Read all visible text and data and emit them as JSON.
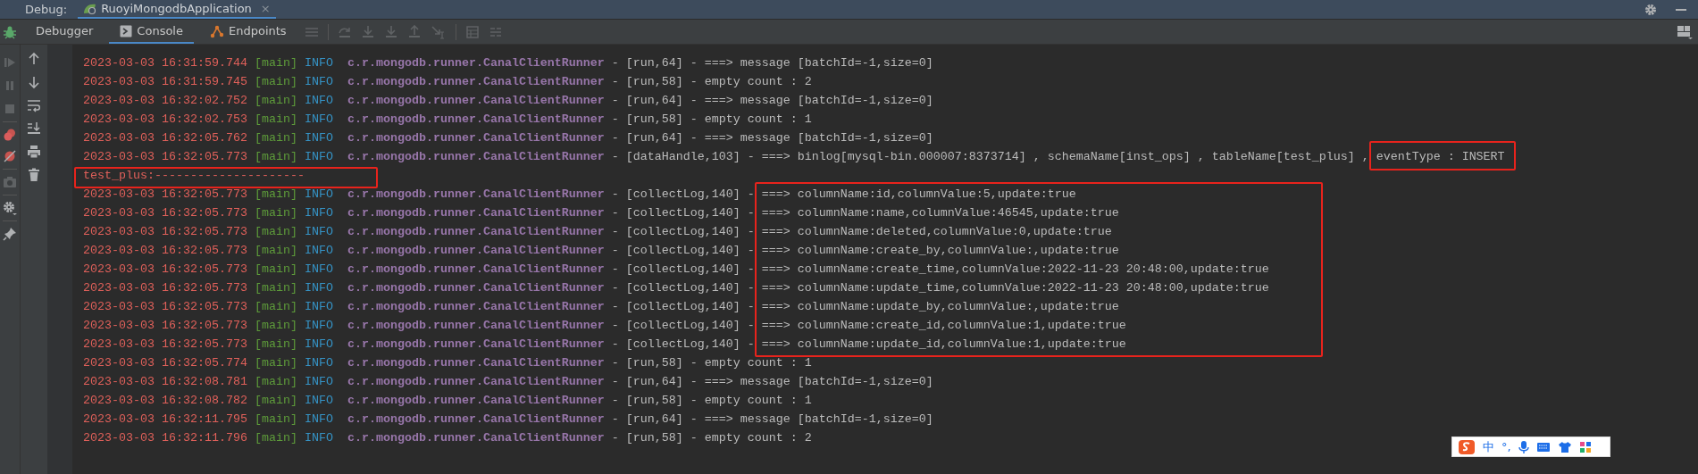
{
  "debug_bar": {
    "label": "Debug:",
    "tab": {
      "title": "RuoyiMongodbApplication",
      "selected": true,
      "close": "×"
    }
  },
  "toolbar": {
    "tabs": [
      {
        "label": "Debugger",
        "selected": false,
        "kind": "text"
      },
      {
        "label": "Console",
        "selected": true,
        "kind": "console"
      },
      {
        "label": "Endpoints",
        "selected": false,
        "kind": "endpoints"
      }
    ]
  },
  "console_lines": [
    {
      "kind": "log",
      "timestamp": "2023-03-03 16:31:59.744",
      "thread": "[main]",
      "level": "INFO",
      "logger": "c.r.mongodb.runner.CanalClientRunner",
      "message": "- [run,64] - ===> message [batchId=-1,size=0]"
    },
    {
      "kind": "log",
      "timestamp": "2023-03-03 16:31:59.745",
      "thread": "[main]",
      "level": "INFO",
      "logger": "c.r.mongodb.runner.CanalClientRunner",
      "message": "- [run,58] - empty count : 2"
    },
    {
      "kind": "log",
      "timestamp": "2023-03-03 16:32:02.752",
      "thread": "[main]",
      "level": "INFO",
      "logger": "c.r.mongodb.runner.CanalClientRunner",
      "message": "- [run,64] - ===> message [batchId=-1,size=0]"
    },
    {
      "kind": "log",
      "timestamp": "2023-03-03 16:32:02.753",
      "thread": "[main]",
      "level": "INFO",
      "logger": "c.r.mongodb.runner.CanalClientRunner",
      "message": "- [run,58] - empty count : 1"
    },
    {
      "kind": "log",
      "timestamp": "2023-03-03 16:32:05.762",
      "thread": "[main]",
      "level": "INFO",
      "logger": "c.r.mongodb.runner.CanalClientRunner",
      "message": "- [run,64] - ===> message [batchId=-1,size=0]"
    },
    {
      "kind": "log",
      "timestamp": "2023-03-03 16:32:05.773",
      "thread": "[main]",
      "level": "INFO",
      "logger": "c.r.mongodb.runner.CanalClientRunner",
      "message": "- [dataHandle,103] - ===> binlog[mysql-bin.000007:8373714] , schemaName[inst_ops] , tableName[test_plus] , eventType : INSERT"
    },
    {
      "kind": "plain",
      "text": "test_plus:---------------------"
    },
    {
      "kind": "log",
      "timestamp": "2023-03-03 16:32:05.773",
      "thread": "[main]",
      "level": "INFO",
      "logger": "c.r.mongodb.runner.CanalClientRunner",
      "message": "- [collectLog,140] - ===> columnName:id,columnValue:5,update:true"
    },
    {
      "kind": "log",
      "timestamp": "2023-03-03 16:32:05.773",
      "thread": "[main]",
      "level": "INFO",
      "logger": "c.r.mongodb.runner.CanalClientRunner",
      "message": "- [collectLog,140] - ===> columnName:name,columnValue:46545,update:true"
    },
    {
      "kind": "log",
      "timestamp": "2023-03-03 16:32:05.773",
      "thread": "[main]",
      "level": "INFO",
      "logger": "c.r.mongodb.runner.CanalClientRunner",
      "message": "- [collectLog,140] - ===> columnName:deleted,columnValue:0,update:true"
    },
    {
      "kind": "log",
      "timestamp": "2023-03-03 16:32:05.773",
      "thread": "[main]",
      "level": "INFO",
      "logger": "c.r.mongodb.runner.CanalClientRunner",
      "message": "- [collectLog,140] - ===> columnName:create_by,columnValue:,update:true"
    },
    {
      "kind": "log",
      "timestamp": "2023-03-03 16:32:05.773",
      "thread": "[main]",
      "level": "INFO",
      "logger": "c.r.mongodb.runner.CanalClientRunner",
      "message": "- [collectLog,140] - ===> columnName:create_time,columnValue:2022-11-23 20:48:00,update:true"
    },
    {
      "kind": "log",
      "timestamp": "2023-03-03 16:32:05.773",
      "thread": "[main]",
      "level": "INFO",
      "logger": "c.r.mongodb.runner.CanalClientRunner",
      "message": "- [collectLog,140] - ===> columnName:update_time,columnValue:2022-11-23 20:48:00,update:true"
    },
    {
      "kind": "log",
      "timestamp": "2023-03-03 16:32:05.773",
      "thread": "[main]",
      "level": "INFO",
      "logger": "c.r.mongodb.runner.CanalClientRunner",
      "message": "- [collectLog,140] - ===> columnName:update_by,columnValue:,update:true"
    },
    {
      "kind": "log",
      "timestamp": "2023-03-03 16:32:05.773",
      "thread": "[main]",
      "level": "INFO",
      "logger": "c.r.mongodb.runner.CanalClientRunner",
      "message": "- [collectLog,140] - ===> columnName:create_id,columnValue:1,update:true"
    },
    {
      "kind": "log",
      "timestamp": "2023-03-03 16:32:05.773",
      "thread": "[main]",
      "level": "INFO",
      "logger": "c.r.mongodb.runner.CanalClientRunner",
      "message": "- [collectLog,140] - ===> columnName:update_id,columnValue:1,update:true"
    },
    {
      "kind": "log",
      "timestamp": "2023-03-03 16:32:05.774",
      "thread": "[main]",
      "level": "INFO",
      "logger": "c.r.mongodb.runner.CanalClientRunner",
      "message": "- [run,58] - empty count : 1"
    },
    {
      "kind": "log",
      "timestamp": "2023-03-03 16:32:08.781",
      "thread": "[main]",
      "level": "INFO",
      "logger": "c.r.mongodb.runner.CanalClientRunner",
      "message": "- [run,64] - ===> message [batchId=-1,size=0]"
    },
    {
      "kind": "log",
      "timestamp": "2023-03-03 16:32:08.782",
      "thread": "[main]",
      "level": "INFO",
      "logger": "c.r.mongodb.runner.CanalClientRunner",
      "message": "- [run,58] - empty count : 1"
    },
    {
      "kind": "log",
      "timestamp": "2023-03-03 16:32:11.795",
      "thread": "[main]",
      "level": "INFO",
      "logger": "c.r.mongodb.runner.CanalClientRunner",
      "message": "- [run,64] - ===> message [batchId=-1,size=0]"
    },
    {
      "kind": "log",
      "timestamp": "2023-03-03 16:32:11.796",
      "thread": "[main]",
      "level": "INFO",
      "logger": "c.r.mongodb.runner.CanalClientRunner",
      "message": "- [run,58] - empty count : 2"
    }
  ],
  "ime_bar": {
    "mode": "中",
    "punctuation": "°,"
  }
}
